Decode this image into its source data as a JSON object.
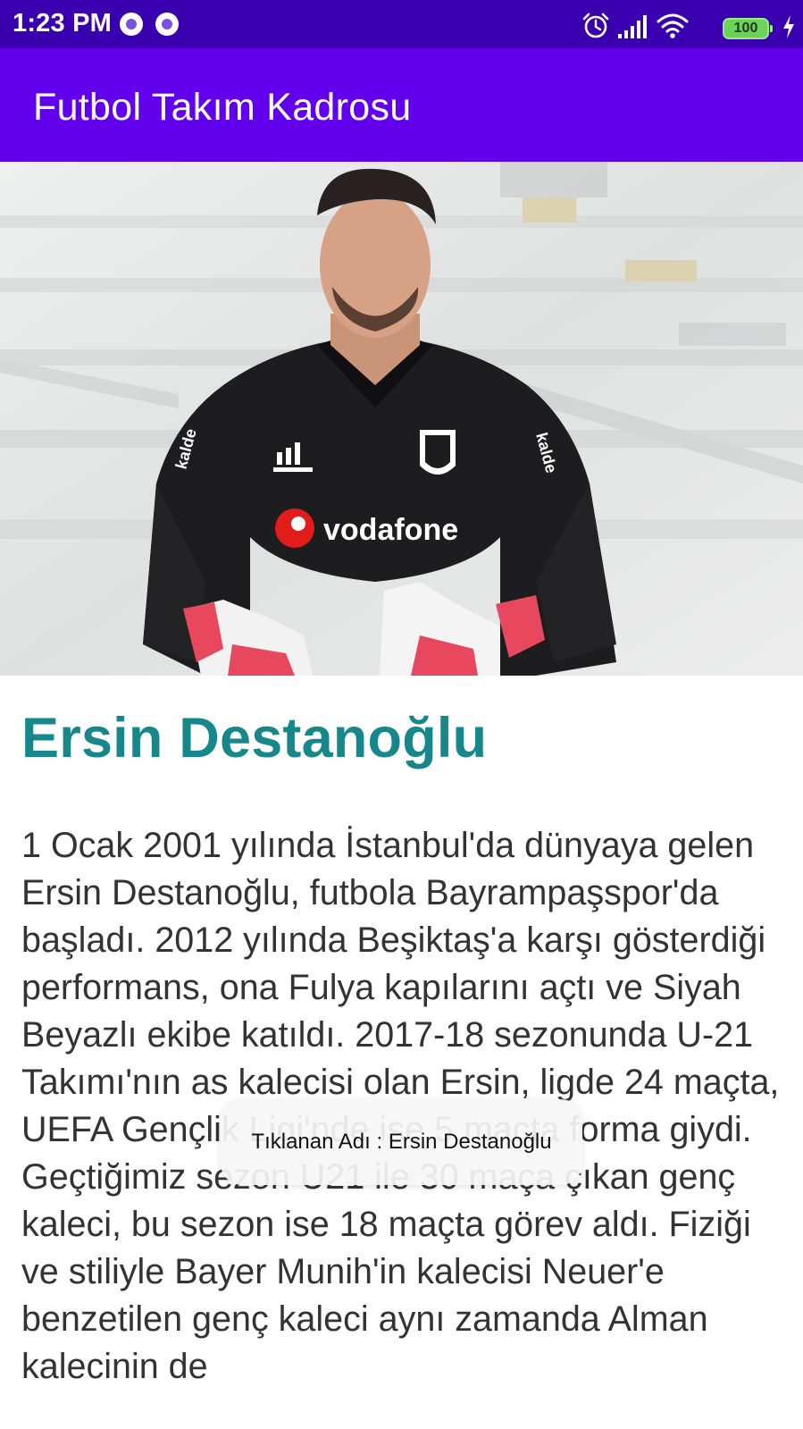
{
  "status_bar": {
    "time": "1:23 PM",
    "battery_level": "100",
    "icons": [
      "notification-dot-icon",
      "notification-dot-icon",
      "alarm-icon",
      "signal-icon",
      "wifi-icon",
      "battery-icon",
      "charging-icon"
    ]
  },
  "app_bar": {
    "title": "Futbol Takım Kadrosu"
  },
  "player": {
    "name": "Ersin Destanoğlu",
    "image_label": "vodafone",
    "bio": "1 Ocak 2001 yılında İstanbul'da dünyaya gelen Ersin Destanoğlu, futbola Bayrampaşspor'da başladı. 2012 yılında Beşiktaş'a karşı gösterdiği performans, ona Fulya kapılarını açtı ve Siyah Beyazlı ekibe katıldı. 2017-18 sezonunda U-21 Takımı'nın as kalecisi olan Ersin, ligde 24 maçta, UEFA Gençlik Ligi'nde ise 5 maçta forma giydi. Geçtiğimiz sezon U21 ile 30 maça çıkan genç kaleci, bu sezon ise 18 maçta görev aldı. Fiziği ve stiliyle Bayer Munih'in kalecisi Neuer'e benzetilen genç kaleci aynı zamanda Alman kalecinin de"
  },
  "toast": {
    "message": "Tıklanan Adı : Ersin Destanoğlu"
  },
  "colors": {
    "status_bar": "#3a00b0",
    "app_bar": "#6200ee",
    "name_teal": "#16878a",
    "body_text": "#333333"
  }
}
